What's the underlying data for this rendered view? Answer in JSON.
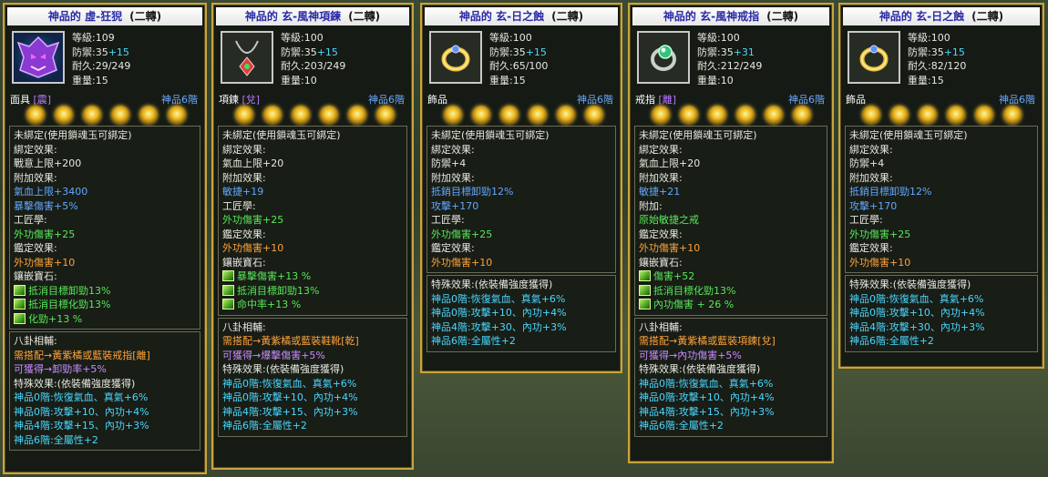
{
  "panels": [
    {
      "title": "神品的 虛-狂猊",
      "rank": "(二轉)",
      "icon": "purple-tiger-mask-icon",
      "stats": [
        {
          "label": "等級:",
          "value": "109",
          "bonus": ""
        },
        {
          "label": "防禦:",
          "value": "35",
          "bonus": "+15"
        },
        {
          "label": "耐久:",
          "value": "29/249",
          "bonus": ""
        },
        {
          "label": "重量:",
          "value": "15",
          "bonus": ""
        }
      ],
      "slot": {
        "label": "面具",
        "trigram": "[震]"
      },
      "grade": "神品6階",
      "orbs": 6,
      "sections": [
        [
          {
            "t": "未綁定(使用鎖魂玉可綁定)",
            "c": "white"
          },
          {
            "t": "綁定效果:",
            "c": "white"
          },
          {
            "t": "戰意上限+200",
            "c": "white"
          },
          {
            "t": "附加效果:",
            "c": "white"
          },
          {
            "t": "氣血上限+3400",
            "c": "blue"
          },
          {
            "t": "暴擊傷害+5%",
            "c": "blue"
          },
          {
            "t": "工匠學:",
            "c": "white"
          },
          {
            "t": "外功傷害+25",
            "c": "green"
          },
          {
            "t": "鑑定效果:",
            "c": "white"
          },
          {
            "t": "外功傷害+10",
            "c": "orange"
          },
          {
            "t": "鑲嵌寶石:",
            "c": "white"
          },
          {
            "t": "抵消目標卸勁13%",
            "c": "green",
            "gem": true
          },
          {
            "t": "抵消目標化勁13%",
            "c": "green",
            "gem": true
          },
          {
            "t": "化勁+13 %",
            "c": "green",
            "gem": true
          }
        ],
        [
          {
            "t": "八卦相輔:",
            "c": "white"
          },
          {
            "t": "需搭配→黃紫橘或藍裝戒指[離]",
            "c": "orange"
          },
          {
            "t": "可獲得→卸勁率+5%",
            "c": "lilac"
          },
          {
            "t": "特殊效果:(依裝備強度獲得)",
            "c": "white"
          },
          {
            "t": "神品0階:恢復氣血、真氣+6%",
            "c": "cyan"
          },
          {
            "t": "神品0階:攻擊+10、內功+4%",
            "c": "cyan"
          },
          {
            "t": "神品4階:攻擊+15、內功+3%",
            "c": "cyan"
          },
          {
            "t": "神品6階:全屬性+2",
            "c": "cyan"
          }
        ]
      ]
    },
    {
      "title": "神品的 玄-風神項鍊",
      "rank": "(二轉)",
      "icon": "necklace-icon",
      "stats": [
        {
          "label": "等級:",
          "value": "100",
          "bonus": ""
        },
        {
          "label": "防禦:",
          "value": "35",
          "bonus": "+15"
        },
        {
          "label": "耐久:",
          "value": "203/249",
          "bonus": ""
        },
        {
          "label": "重量:",
          "value": "10",
          "bonus": ""
        }
      ],
      "slot": {
        "label": "項鍊",
        "trigram": "[兌]"
      },
      "grade": "神品6階",
      "orbs": 6,
      "sections": [
        [
          {
            "t": "未綁定(使用鎖魂玉可綁定)",
            "c": "white"
          },
          {
            "t": "綁定效果:",
            "c": "white"
          },
          {
            "t": "氣血上限+20",
            "c": "white"
          },
          {
            "t": "附加效果:",
            "c": "white"
          },
          {
            "t": "敏捷+19",
            "c": "blue"
          },
          {
            "t": "工匠學:",
            "c": "white"
          },
          {
            "t": "外功傷害+25",
            "c": "green"
          },
          {
            "t": "鑑定效果:",
            "c": "white"
          },
          {
            "t": "外功傷害+10",
            "c": "orange"
          },
          {
            "t": "鑲嵌寶石:",
            "c": "white"
          },
          {
            "t": "暴擊傷害+13 %",
            "c": "green",
            "gem": true
          },
          {
            "t": "抵消目標卸勁13%",
            "c": "green",
            "gem": true
          },
          {
            "t": "命中率+13 %",
            "c": "green",
            "gem": true
          }
        ],
        [
          {
            "t": "八卦相輔:",
            "c": "white"
          },
          {
            "t": "需搭配→黃紫橘或藍裝鞋靴[乾]",
            "c": "orange"
          },
          {
            "t": "可獲得→爆擊傷害+5%",
            "c": "lilac"
          },
          {
            "t": "特殊效果:(依裝備強度獲得)",
            "c": "white"
          },
          {
            "t": "神品0階:恢復氣血、真氣+6%",
            "c": "cyan"
          },
          {
            "t": "神品0階:攻擊+10、內功+4%",
            "c": "cyan"
          },
          {
            "t": "神品4階:攻擊+15、內功+3%",
            "c": "cyan"
          },
          {
            "t": "神品6階:全屬性+2",
            "c": "cyan"
          }
        ]
      ]
    },
    {
      "title": "神品的 玄-日之蝕",
      "rank": "(二轉)",
      "icon": "gold-ring-icon",
      "stats": [
        {
          "label": "等級:",
          "value": "100",
          "bonus": ""
        },
        {
          "label": "防禦:",
          "value": "35",
          "bonus": "+15"
        },
        {
          "label": "耐久:",
          "value": "65/100",
          "bonus": ""
        },
        {
          "label": "重量:",
          "value": "15",
          "bonus": ""
        }
      ],
      "slot": {
        "label": "飾品",
        "trigram": ""
      },
      "grade": "神品6階",
      "orbs": 6,
      "sections": [
        [
          {
            "t": "未綁定(使用鎖魂玉可綁定)",
            "c": "white"
          },
          {
            "t": "綁定效果:",
            "c": "white"
          },
          {
            "t": "防禦+4",
            "c": "white"
          },
          {
            "t": "附加效果:",
            "c": "white"
          },
          {
            "t": "抵銷目標卸勁12%",
            "c": "blue"
          },
          {
            "t": "攻擊+170",
            "c": "blue"
          },
          {
            "t": "工匠學:",
            "c": "white"
          },
          {
            "t": "外功傷害+25",
            "c": "green"
          },
          {
            "t": "鑑定效果:",
            "c": "white"
          },
          {
            "t": "外功傷害+10",
            "c": "orange"
          }
        ],
        [
          {
            "t": "特殊效果:(依裝備強度獲得)",
            "c": "white"
          },
          {
            "t": "神品0階:恢復氣血、真氣+6%",
            "c": "cyan"
          },
          {
            "t": "神品0階:攻擊+10、內功+4%",
            "c": "cyan"
          },
          {
            "t": "神品4階:攻擊+30、內功+3%",
            "c": "cyan"
          },
          {
            "t": "神品6階:全屬性+2",
            "c": "cyan"
          }
        ]
      ]
    },
    {
      "title": "神品的 玄-風神戒指",
      "rank": "(二轉)",
      "icon": "jade-ring-icon",
      "stats": [
        {
          "label": "等級:",
          "value": "100",
          "bonus": ""
        },
        {
          "label": "防禦:",
          "value": "35",
          "bonus": "+31"
        },
        {
          "label": "耐久:",
          "value": "212/249",
          "bonus": ""
        },
        {
          "label": "重量:",
          "value": "10",
          "bonus": ""
        }
      ],
      "slot": {
        "label": "戒指",
        "trigram": "[離]"
      },
      "grade": "神品6階",
      "orbs": 6,
      "sections": [
        [
          {
            "t": "未綁定(使用鎖魂玉可綁定)",
            "c": "white"
          },
          {
            "t": "綁定效果:",
            "c": "white"
          },
          {
            "t": "氣血上限+20",
            "c": "white"
          },
          {
            "t": "附加效果:",
            "c": "white"
          },
          {
            "t": "敏捷+21",
            "c": "blue"
          },
          {
            "t": "附加:",
            "c": "white"
          },
          {
            "t": "原始敏捷之戒",
            "c": "green"
          },
          {
            "t": "鑑定效果:",
            "c": "white"
          },
          {
            "t": "外功傷害+10",
            "c": "orange"
          },
          {
            "t": "鑲嵌寶石:",
            "c": "white"
          },
          {
            "t": "傷害+52",
            "c": "green",
            "gem": true
          },
          {
            "t": "抵消目標化勁13%",
            "c": "green",
            "gem": true
          },
          {
            "t": "內功傷害 + 26 %",
            "c": "green",
            "gem": true
          }
        ],
        [
          {
            "t": "八卦相輔:",
            "c": "white"
          },
          {
            "t": "需搭配→黃紫橘或藍裝項鍊[兌]",
            "c": "orange"
          },
          {
            "t": "可獲得→內功傷害+5%",
            "c": "lilac"
          },
          {
            "t": "特殊效果:(依裝備強度獲得)",
            "c": "white"
          },
          {
            "t": "神品0階:恢復氣血、真氣+6%",
            "c": "cyan"
          },
          {
            "t": "神品0階:攻擊+10、內功+4%",
            "c": "cyan"
          },
          {
            "t": "神品4階:攻擊+15、內功+3%",
            "c": "cyan"
          },
          {
            "t": "神品6階:全屬性+2",
            "c": "cyan"
          }
        ]
      ]
    },
    {
      "title": "神品的 玄-日之蝕",
      "rank": "(二轉)",
      "icon": "gold-ring-icon",
      "stats": [
        {
          "label": "等級:",
          "value": "100",
          "bonus": ""
        },
        {
          "label": "防禦:",
          "value": "35",
          "bonus": "+15"
        },
        {
          "label": "耐久:",
          "value": "82/120",
          "bonus": ""
        },
        {
          "label": "重量:",
          "value": "15",
          "bonus": ""
        }
      ],
      "slot": {
        "label": "飾品",
        "trigram": ""
      },
      "grade": "神品6階",
      "orbs": 6,
      "sections": [
        [
          {
            "t": "未綁定(使用鎖魂玉可綁定)",
            "c": "white"
          },
          {
            "t": "綁定效果:",
            "c": "white"
          },
          {
            "t": "防禦+4",
            "c": "white"
          },
          {
            "t": "附加效果:",
            "c": "white"
          },
          {
            "t": "抵銷目標卸勁12%",
            "c": "blue"
          },
          {
            "t": "攻擊+170",
            "c": "blue"
          },
          {
            "t": "工匠學:",
            "c": "white"
          },
          {
            "t": "外功傷害+25",
            "c": "green"
          },
          {
            "t": "鑑定效果:",
            "c": "white"
          },
          {
            "t": "外功傷害+10",
            "c": "orange"
          }
        ],
        [
          {
            "t": "特殊效果:(依裝備強度獲得)",
            "c": "white"
          },
          {
            "t": "神品0階:恢復氣血、真氣+6%",
            "c": "cyan"
          },
          {
            "t": "神品0階:攻擊+10、內功+4%",
            "c": "cyan"
          },
          {
            "t": "神品4階:攻擊+30、內功+3%",
            "c": "cyan"
          },
          {
            "t": "神品6階:全屬性+2",
            "c": "cyan"
          }
        ]
      ]
    }
  ]
}
